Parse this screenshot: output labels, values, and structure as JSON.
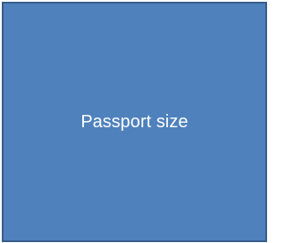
{
  "photo_placeholder": {
    "label": "Passport size",
    "fill_color": "#4f81bd",
    "border_color": "#385d8a",
    "text_color": "#ffffff"
  }
}
